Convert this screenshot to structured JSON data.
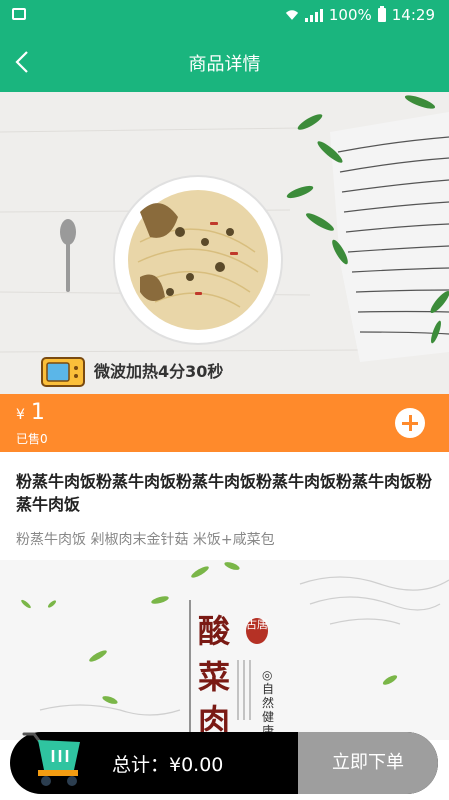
{
  "status_bar": {
    "battery": "100%",
    "time": "14:29"
  },
  "header": {
    "title": "商品详情"
  },
  "product": {
    "heating_label": "微波加热4分30秒",
    "currency": "¥",
    "price": "1",
    "sold": "已售0",
    "name": "粉蒸牛肉饭粉蒸牛肉饭粉蒸牛肉饭粉蒸牛肉饭粉蒸牛肉饭粉蒸牛肉饭",
    "description": "粉蒸牛肉饭 剁椒肉末金针菇 米饭+咸菜包"
  },
  "poster": {
    "chars": [
      "酸",
      "菜",
      "肉"
    ],
    "seal_text": "古唐",
    "vertical_text": "◎自然健康◎"
  },
  "cart": {
    "total_label": "总计：¥0.00",
    "order_button": "立即下单"
  },
  "colors": {
    "primary": "#1ab57e",
    "accent": "#ff8a2b",
    "checkout_disabled": "#9e9e9e"
  }
}
